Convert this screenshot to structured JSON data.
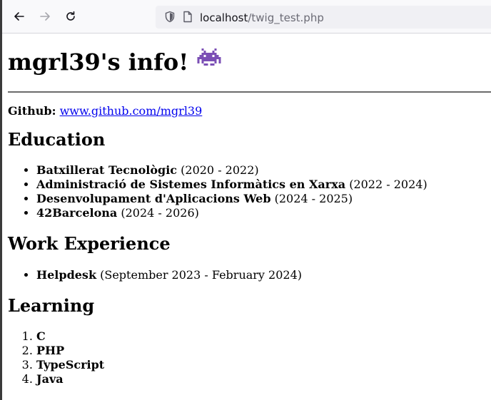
{
  "browser": {
    "url_host": "localhost",
    "url_path": "/twig_test.php"
  },
  "page": {
    "title": "mgrl39's info!",
    "title_emoji": "space-invader-icon",
    "github_label": "Github:",
    "github_link": "www.github.com/mgrl39",
    "sections": {
      "education": {
        "heading": "Education",
        "items": [
          {
            "name": "Batxillerat Tecnològic",
            "period": "(2020 - 2022)"
          },
          {
            "name": "Administració de Sistemes Informàtics en Xarxa",
            "period": "(2022 - 2024)"
          },
          {
            "name": "Desenvolupament d'Aplicacions Web",
            "period": "(2024 - 2025)"
          },
          {
            "name": "42Barcelona",
            "period": "(2024 - 2026)"
          }
        ]
      },
      "work": {
        "heading": "Work Experience",
        "items": [
          {
            "name": "Helpdesk",
            "period": "(September 2023 - February 2024)"
          }
        ]
      },
      "learning": {
        "heading": "Learning",
        "items": [
          "C",
          "PHP",
          "TypeScript",
          "Java"
        ]
      }
    }
  },
  "colors": {
    "link": "#0000ee",
    "invader": "#7b4fb5"
  }
}
